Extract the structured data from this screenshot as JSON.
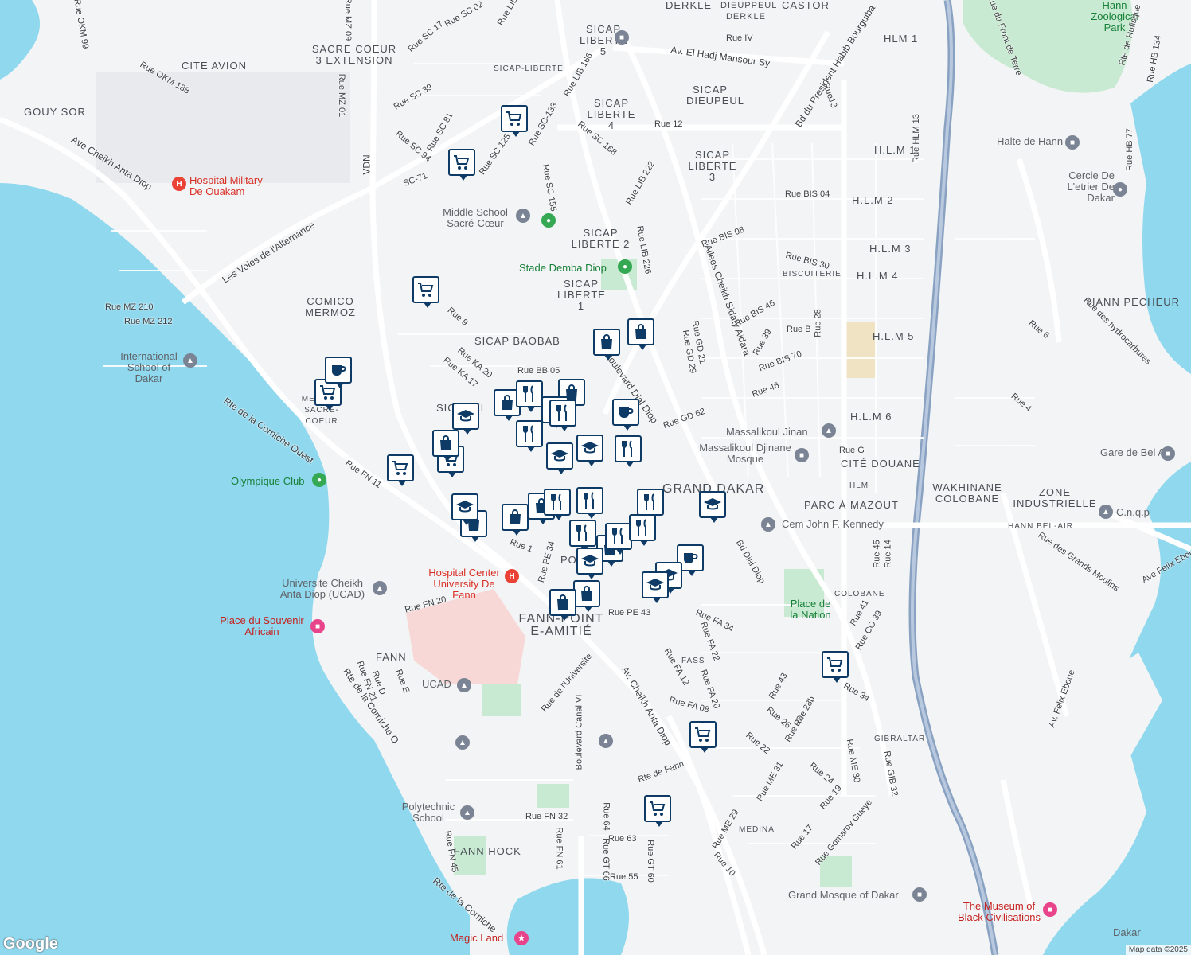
{
  "map": {
    "attribution": "Map data ©2025",
    "logo": "Google",
    "districts": [
      {
        "id": "derkle",
        "text": "DERKLE"
      },
      {
        "id": "dieuppeul-derkle",
        "text": "DIEUPPEUL DERKLE"
      },
      {
        "id": "castor",
        "text": "CASTOR"
      },
      {
        "id": "hlm1",
        "text": "HLM 1"
      },
      {
        "id": "sicap5",
        "text": "SICAP LIBERTE 5"
      },
      {
        "id": "sacrecoeur3",
        "text": "SACRE COEUR 3 EXTENSION"
      },
      {
        "id": "citeavion",
        "text": "CITE AVION"
      },
      {
        "id": "gouysor",
        "text": "GOUY SOR"
      },
      {
        "id": "sicapliberte",
        "text": "SICAP-LIBERTÉ"
      },
      {
        "id": "sicapdieupeul",
        "text": "SICAP DIEUPEUL"
      },
      {
        "id": "sicap4",
        "text": "SICAP LIBERTE 4"
      },
      {
        "id": "sicap3",
        "text": "SICAP LIBERTE 3"
      },
      {
        "id": "hlm1b",
        "text": "H.L.M 1"
      },
      {
        "id": "hlm2",
        "text": "H.L.M 2"
      },
      {
        "id": "sicap2",
        "text": "SICAP LIBERTE 2"
      },
      {
        "id": "hlm3",
        "text": "H.L.M 3"
      },
      {
        "id": "hlm4",
        "text": "H.L.M 4"
      },
      {
        "id": "biscuiterie",
        "text": "BISCUITERIE"
      },
      {
        "id": "hannpecheur",
        "text": "HANN PECHEUR"
      },
      {
        "id": "sicap1",
        "text": "SICAP LIBERTE 1"
      },
      {
        "id": "comico",
        "text": "COMICO MERMOZ"
      },
      {
        "id": "sicapbaobab",
        "text": "SICAP BAOBAB"
      },
      {
        "id": "hlm5",
        "text": "H.L.M 5"
      },
      {
        "id": "hlm6",
        "text": "H.L.M 6"
      },
      {
        "id": "mermoz",
        "text": "MERMOZ SACRE-COEUR"
      },
      {
        "id": "citedouane",
        "text": "CITÉ DOUANE"
      },
      {
        "id": "granddakar",
        "text": "GRAND DAKAR"
      },
      {
        "id": "wakhinane",
        "text": "WAKHINANE COLOBANE"
      },
      {
        "id": "zoneind",
        "text": "ZONE INDUSTRIELLE"
      },
      {
        "id": "hlm",
        "text": "HLM"
      },
      {
        "id": "parcmazout",
        "text": "PARC À MAZOUT"
      },
      {
        "id": "hannbelair",
        "text": "HANN BEL-AIR"
      },
      {
        "id": "colobane",
        "text": "COLOBANE"
      },
      {
        "id": "fannpoint",
        "text": "FANN-POINT E-AMITIÉ"
      },
      {
        "id": "fann",
        "text": "FANN"
      },
      {
        "id": "fass",
        "text": "FASS"
      },
      {
        "id": "gibraltar",
        "text": "GIBRALTAR"
      },
      {
        "id": "medina",
        "text": "MEDINA"
      },
      {
        "id": "fannhock",
        "text": "FANN HOCK"
      },
      {
        "id": "po",
        "text": "PO"
      },
      {
        "id": "sic",
        "text": "SIC"
      },
      {
        "id": "ai",
        "text": "AI"
      }
    ],
    "pois": [
      {
        "id": "zoo",
        "text": "Hann Zoological Park"
      },
      {
        "id": "hospmil",
        "text": "Hospital Military De Ouakam"
      },
      {
        "id": "haltehann",
        "text": "Halte de Hann"
      },
      {
        "id": "cercle",
        "text": "Cercle De L'etrier De Dakar"
      },
      {
        "id": "middle",
        "text": "Middle School Sacré-Cœur"
      },
      {
        "id": "stade",
        "text": "Stade Demba Diop"
      },
      {
        "id": "intl",
        "text": "International School of Dakar"
      },
      {
        "id": "olympique",
        "text": "Olympique Club"
      },
      {
        "id": "massalikoul",
        "text": "Massalikoul Jinan"
      },
      {
        "id": "mosque",
        "text": "Massalikoul Djinane Mosque"
      },
      {
        "id": "garebelair",
        "text": "Gare de Bel Air"
      },
      {
        "id": "cnqp",
        "text": "C.n.q.p"
      },
      {
        "id": "cemjfk",
        "text": "Cem John F. Kennedy"
      },
      {
        "id": "placenation",
        "text": "Place de la Nation"
      },
      {
        "id": "hospfann",
        "text": "Hospital Center University De Fann"
      },
      {
        "id": "ucadfull",
        "text": "Universite Cheikh Anta Diop (UCAD)"
      },
      {
        "id": "souvenir",
        "text": "Place du Souvenir Africain"
      },
      {
        "id": "ucad",
        "text": "UCAD"
      },
      {
        "id": "poly",
        "text": "Polytechnic School"
      },
      {
        "id": "grandmosque",
        "text": "Grand Mosque of Dakar"
      },
      {
        "id": "museum",
        "text": "The Museum of Black Civilisations"
      },
      {
        "id": "magicland",
        "text": "Magic Land"
      },
      {
        "id": "dakar",
        "text": "Dakar"
      }
    ],
    "streets": [
      {
        "id": "s1",
        "text": "Rue SC 02"
      },
      {
        "id": "s2",
        "text": "Rue LIB"
      },
      {
        "id": "s3",
        "text": "Rue SC 17"
      },
      {
        "id": "s4",
        "text": "Rue MZ 09"
      },
      {
        "id": "s5",
        "text": "Rue OKM 99"
      },
      {
        "id": "s6",
        "text": "Rue IV"
      },
      {
        "id": "s7",
        "text": "Av. El Hadj Mansour Sy"
      },
      {
        "id": "s8",
        "text": "Rue LIB 166"
      },
      {
        "id": "s9",
        "text": "Rue OKM 188"
      },
      {
        "id": "s10",
        "text": "Rue MZ 01"
      },
      {
        "id": "s11",
        "text": "Rue SC 39"
      },
      {
        "id": "s12",
        "text": "Rue SC 81"
      },
      {
        "id": "s13",
        "text": "Rue SC 94"
      },
      {
        "id": "s14",
        "text": "Rue SC-133"
      },
      {
        "id": "s15",
        "text": "Rue SC 168"
      },
      {
        "id": "s16",
        "text": "Rue 12"
      },
      {
        "id": "s17",
        "text": "Ave Cheikh Anta Diop"
      },
      {
        "id": "s18",
        "text": "Rue SC 125"
      },
      {
        "id": "s19",
        "text": "SC-71"
      },
      {
        "id": "s20",
        "text": "VDN"
      },
      {
        "id": "s21",
        "text": "Rue SC 155"
      },
      {
        "id": "s22",
        "text": "Rue LIB 222"
      },
      {
        "id": "s23",
        "text": "Bd du President Habib Bourguiba"
      },
      {
        "id": "s24",
        "text": "Rue13"
      },
      {
        "id": "s25",
        "text": "Rue du Front de Terre"
      },
      {
        "id": "s26",
        "text": "Rte de Rufisque"
      },
      {
        "id": "s27",
        "text": "Rue HB 134"
      },
      {
        "id": "s28",
        "text": "Rue HLM 13"
      },
      {
        "id": "s29",
        "text": "Rue HB 77"
      },
      {
        "id": "s30",
        "text": "Rue BIS 04"
      },
      {
        "id": "s31",
        "text": "Les Voies de l'Alternance"
      },
      {
        "id": "s32",
        "text": "Rte de la Corniche Ouest"
      },
      {
        "id": "s33",
        "text": "Rue BIS 08"
      },
      {
        "id": "s34",
        "text": "Rue LIB 226"
      },
      {
        "id": "s35",
        "text": "Rue BIS 30"
      },
      {
        "id": "s36",
        "text": "Rue MZ 210"
      },
      {
        "id": "s37",
        "text": "Rue MZ 212"
      },
      {
        "id": "s38",
        "text": "Rue 9"
      },
      {
        "id": "s39",
        "text": "Allees Cheikh Sidaty Aidara"
      },
      {
        "id": "s40",
        "text": "Rue BIS 46"
      },
      {
        "id": "s41",
        "text": "Rue B"
      },
      {
        "id": "s42",
        "text": "Rue 28"
      },
      {
        "id": "s43",
        "text": "Rue 39"
      },
      {
        "id": "s44",
        "text": "Rue BIS 70"
      },
      {
        "id": "s45",
        "text": "Rue KA 20"
      },
      {
        "id": "s46",
        "text": "Rue KA 17"
      },
      {
        "id": "s47",
        "text": "Rue BB 05"
      },
      {
        "id": "s48",
        "text": "Boulevard Dial Diop"
      },
      {
        "id": "s49",
        "text": "Rue GD 21"
      },
      {
        "id": "s50",
        "text": "Rue GD 29"
      },
      {
        "id": "s51",
        "text": "Rue 46"
      },
      {
        "id": "s52",
        "text": "Rue GD 62"
      },
      {
        "id": "s53",
        "text": "Rue G"
      },
      {
        "id": "s54",
        "text": "Rue 4"
      },
      {
        "id": "s55",
        "text": "Rue 6"
      },
      {
        "id": "s56",
        "text": "Rue des hydrocarbures"
      },
      {
        "id": "s57",
        "text": "Rue FN 11"
      },
      {
        "id": "s58",
        "text": "Rue PE 34"
      },
      {
        "id": "s59",
        "text": "Rue 1"
      },
      {
        "id": "s60",
        "text": "Rue 45"
      },
      {
        "id": "s61",
        "text": "Rue 14"
      },
      {
        "id": "s62",
        "text": "Rue des Grands Moulins"
      },
      {
        "id": "s63",
        "text": "Ave Felix Eboue"
      },
      {
        "id": "s64",
        "text": "Bd Dial Diop"
      },
      {
        "id": "s65",
        "text": "Rue FN 20"
      },
      {
        "id": "s66",
        "text": "Rue PE 43"
      },
      {
        "id": "s67",
        "text": "Rue FA 34"
      },
      {
        "id": "s68",
        "text": "Rue FA 22"
      },
      {
        "id": "s69",
        "text": "Rue FA 12"
      },
      {
        "id": "s70",
        "text": "Rue FA 08"
      },
      {
        "id": "s71",
        "text": "Rue FA 20"
      },
      {
        "id": "s72",
        "text": "Rue CO 39"
      },
      {
        "id": "s73",
        "text": "Rue 41"
      },
      {
        "id": "s74",
        "text": "Rue 34"
      },
      {
        "id": "s75",
        "text": "Av. Cheikh Anta Diop"
      },
      {
        "id": "s76",
        "text": "Rue de l'Universite"
      },
      {
        "id": "s77",
        "text": "Rte de la Corniche O"
      },
      {
        "id": "s78",
        "text": "Rue FN 21"
      },
      {
        "id": "s79",
        "text": "Rue E"
      },
      {
        "id": "s80",
        "text": "Rue D"
      },
      {
        "id": "s81",
        "text": "Boulevard Canal VI"
      },
      {
        "id": "s82",
        "text": "Rte de Fann"
      },
      {
        "id": "s83",
        "text": "Rue 43"
      },
      {
        "id": "s84",
        "text": "Rue 26"
      },
      {
        "id": "s85",
        "text": "Rue 33"
      },
      {
        "id": "s86",
        "text": "Rue 28b"
      },
      {
        "id": "s87",
        "text": "Rue 22"
      },
      {
        "id": "s88",
        "text": "Rue ME 31"
      },
      {
        "id": "s89",
        "text": "Rue 24"
      },
      {
        "id": "s90",
        "text": "Rue 19"
      },
      {
        "id": "s91",
        "text": "Rue ME 30"
      },
      {
        "id": "s92",
        "text": "Rue GIB 32"
      },
      {
        "id": "s93",
        "text": "Av. Felix Eboue"
      },
      {
        "id": "s94",
        "text": "Rue FN 32"
      },
      {
        "id": "s95",
        "text": "Rue 64"
      },
      {
        "id": "s96",
        "text": "Rue 63"
      },
      {
        "id": "s97",
        "text": "Rue FN 61"
      },
      {
        "id": "s98",
        "text": "Rue GT 66"
      },
      {
        "id": "s99",
        "text": "Rue GT 60"
      },
      {
        "id": "s100",
        "text": "Rue 55"
      },
      {
        "id": "s101",
        "text": "Rue ME 29"
      },
      {
        "id": "s102",
        "text": "Rue 10"
      },
      {
        "id": "s103",
        "text": "Rue 17"
      },
      {
        "id": "s104",
        "text": "Rue Gomarov Gueye"
      },
      {
        "id": "s105",
        "text": "Rue FN 45"
      },
      {
        "id": "s106",
        "text": "Rte de la Corniche"
      }
    ],
    "markers": [
      {
        "type": "cart",
        "label": "shopping-cart"
      },
      {
        "type": "bag",
        "label": "shopping-bag"
      },
      {
        "type": "fork",
        "label": "restaurant"
      },
      {
        "type": "cup",
        "label": "cafe"
      },
      {
        "type": "cap",
        "label": "school"
      }
    ],
    "colors": {
      "water": "#8fd8ee",
      "land": "#f3f4f6",
      "road": "#ffffff",
      "highway": "#8aa2c2",
      "park": "#c9ead2",
      "hospital": "#f7d8d6",
      "marker": "#0d3b66"
    }
  }
}
